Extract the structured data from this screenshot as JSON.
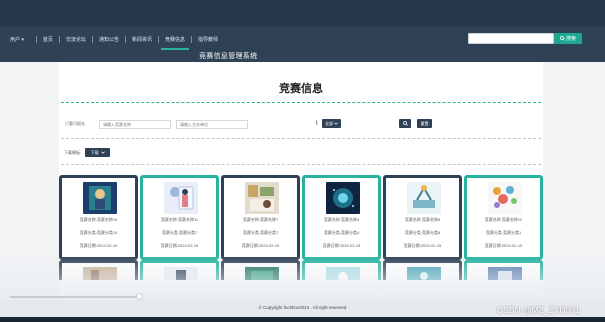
{
  "nav": {
    "user": "用户 ▾",
    "items": [
      {
        "label": "首页",
        "active": false
      },
      {
        "label": "交流论坛",
        "active": false
      },
      {
        "label": "通知公告",
        "active": false
      },
      {
        "label": "新闻资讯",
        "active": false
      },
      {
        "label": "竞赛信息",
        "active": true
      },
      {
        "label": "指导教师",
        "active": false
      }
    ]
  },
  "system_title": "竞赛信息管理系统",
  "top_search": {
    "value": "",
    "button_label": "搜索"
  },
  "page_title": "竞赛信息",
  "filter": {
    "label": "只看可报名",
    "name_placeholder": "请输入竞赛名称",
    "org_placeholder": "请输入主办单位",
    "select_label": "全部",
    "reset_label": "重置"
  },
  "download": {
    "label": "下载模板:",
    "button_label": "下载"
  },
  "cards": [
    {
      "l1": "竞赛名称:竞赛名称10",
      "l2": "竞赛分类:竞赛分类10",
      "l3": "竞赛日期:2024-02-19",
      "border": "#2f4155"
    },
    {
      "l1": "竞赛名称:竞赛名称11",
      "l2": "竞赛分类:竞赛分类7",
      "l3": "竞赛日期:2024-02-19",
      "border": "#28b39f"
    },
    {
      "l1": "竞赛名称:竞赛名称7",
      "l2": "竞赛分类:竞赛分类7",
      "l3": "竞赛日期:2024-02-19",
      "border": "#2f4155"
    },
    {
      "l1": "竞赛名称:竞赛名称4",
      "l2": "竞赛分类:竞赛分类4",
      "l3": "竞赛日期:2024-02-19",
      "border": "#28b39f"
    },
    {
      "l1": "竞赛名称:竞赛名称8",
      "l2": "竞赛分类:竞赛分类8",
      "l3": "竞赛日期:2024-02-19",
      "border": "#2f4155"
    },
    {
      "l1": "竞赛名称:竞赛名称12",
      "l2": "竞赛分类:竞赛分类1",
      "l3": "竞赛日期:2024-02-19",
      "border": "#28b39f"
    }
  ],
  "footer": {
    "copyright": "© Copyright fuckhox2024 . All right reserved"
  },
  "watermark": "CSDN @MZ_ZXD001"
}
